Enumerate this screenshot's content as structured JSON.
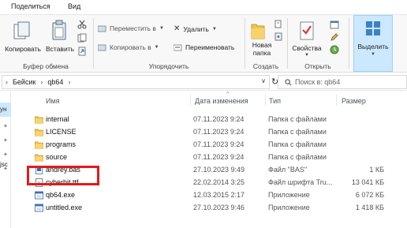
{
  "ribbon_tabs": [
    "Поделиться",
    "Вид"
  ],
  "clipboard": {
    "copy": "Копировать",
    "paste": "Вставить",
    "group": "Буфер обмена"
  },
  "organize": {
    "move_to": "Переместить в",
    "copy_to": "Копировать в",
    "delete": "Удалить",
    "rename": "Переименовать",
    "group": "Упорядочить"
  },
  "create": {
    "new_folder_line1": "Новая",
    "new_folder_line2": "папка",
    "group": "Создать"
  },
  "open": {
    "properties": "Свойства",
    "group": "Открыть"
  },
  "select": {
    "select": "Выделить"
  },
  "address": {
    "crumbs": [
      "Бейсик",
      "qb64"
    ]
  },
  "search": {
    "placeholder": "Поиск в: qb64"
  },
  "nav": {
    "items": [
      "ун",
      "jsc"
    ]
  },
  "columns": {
    "name": "Имя",
    "date": "Дата изменения",
    "type": "Тип",
    "size": "Размер"
  },
  "files": [
    {
      "name": "internal",
      "date": "07.11.2023 9:24",
      "type": "Папка с файлами",
      "size": "",
      "icon": "folder-icon"
    },
    {
      "name": "LICENSE",
      "date": "07.11.2023 9:24",
      "type": "Папка с файлами",
      "size": "",
      "icon": "folder-icon"
    },
    {
      "name": "programs",
      "date": "07.11.2023 9:24",
      "type": "Папка с файлами",
      "size": "",
      "icon": "folder-icon"
    },
    {
      "name": "source",
      "date": "07.11.2023 9:24",
      "type": "Папка с файлами",
      "size": "",
      "icon": "folder-icon"
    },
    {
      "name": "andrey.bas",
      "date": "27.10.2023 9:49",
      "type": "Файл \"BAS\"",
      "size": "1 КБ",
      "icon": "document-icon"
    },
    {
      "name": "cyberbit.ttf",
      "date": "22.02.2014 3:25",
      "type": "Файл шрифта Tru...",
      "size": "13 041 КБ",
      "icon": "font-file-icon"
    },
    {
      "name": "qb64.exe",
      "date": "12.03.2015 2:17",
      "type": "Приложение",
      "size": "6 072 КБ",
      "icon": "application-icon"
    },
    {
      "name": "untitled.exe",
      "date": "27.10.2023 9:46",
      "type": "Приложение",
      "size": "1 418 КБ",
      "icon": "application-icon"
    }
  ],
  "colors": {
    "highlight_box": "#e11b1b",
    "folder": "#f3c54b",
    "selection": "#cce8ff"
  }
}
